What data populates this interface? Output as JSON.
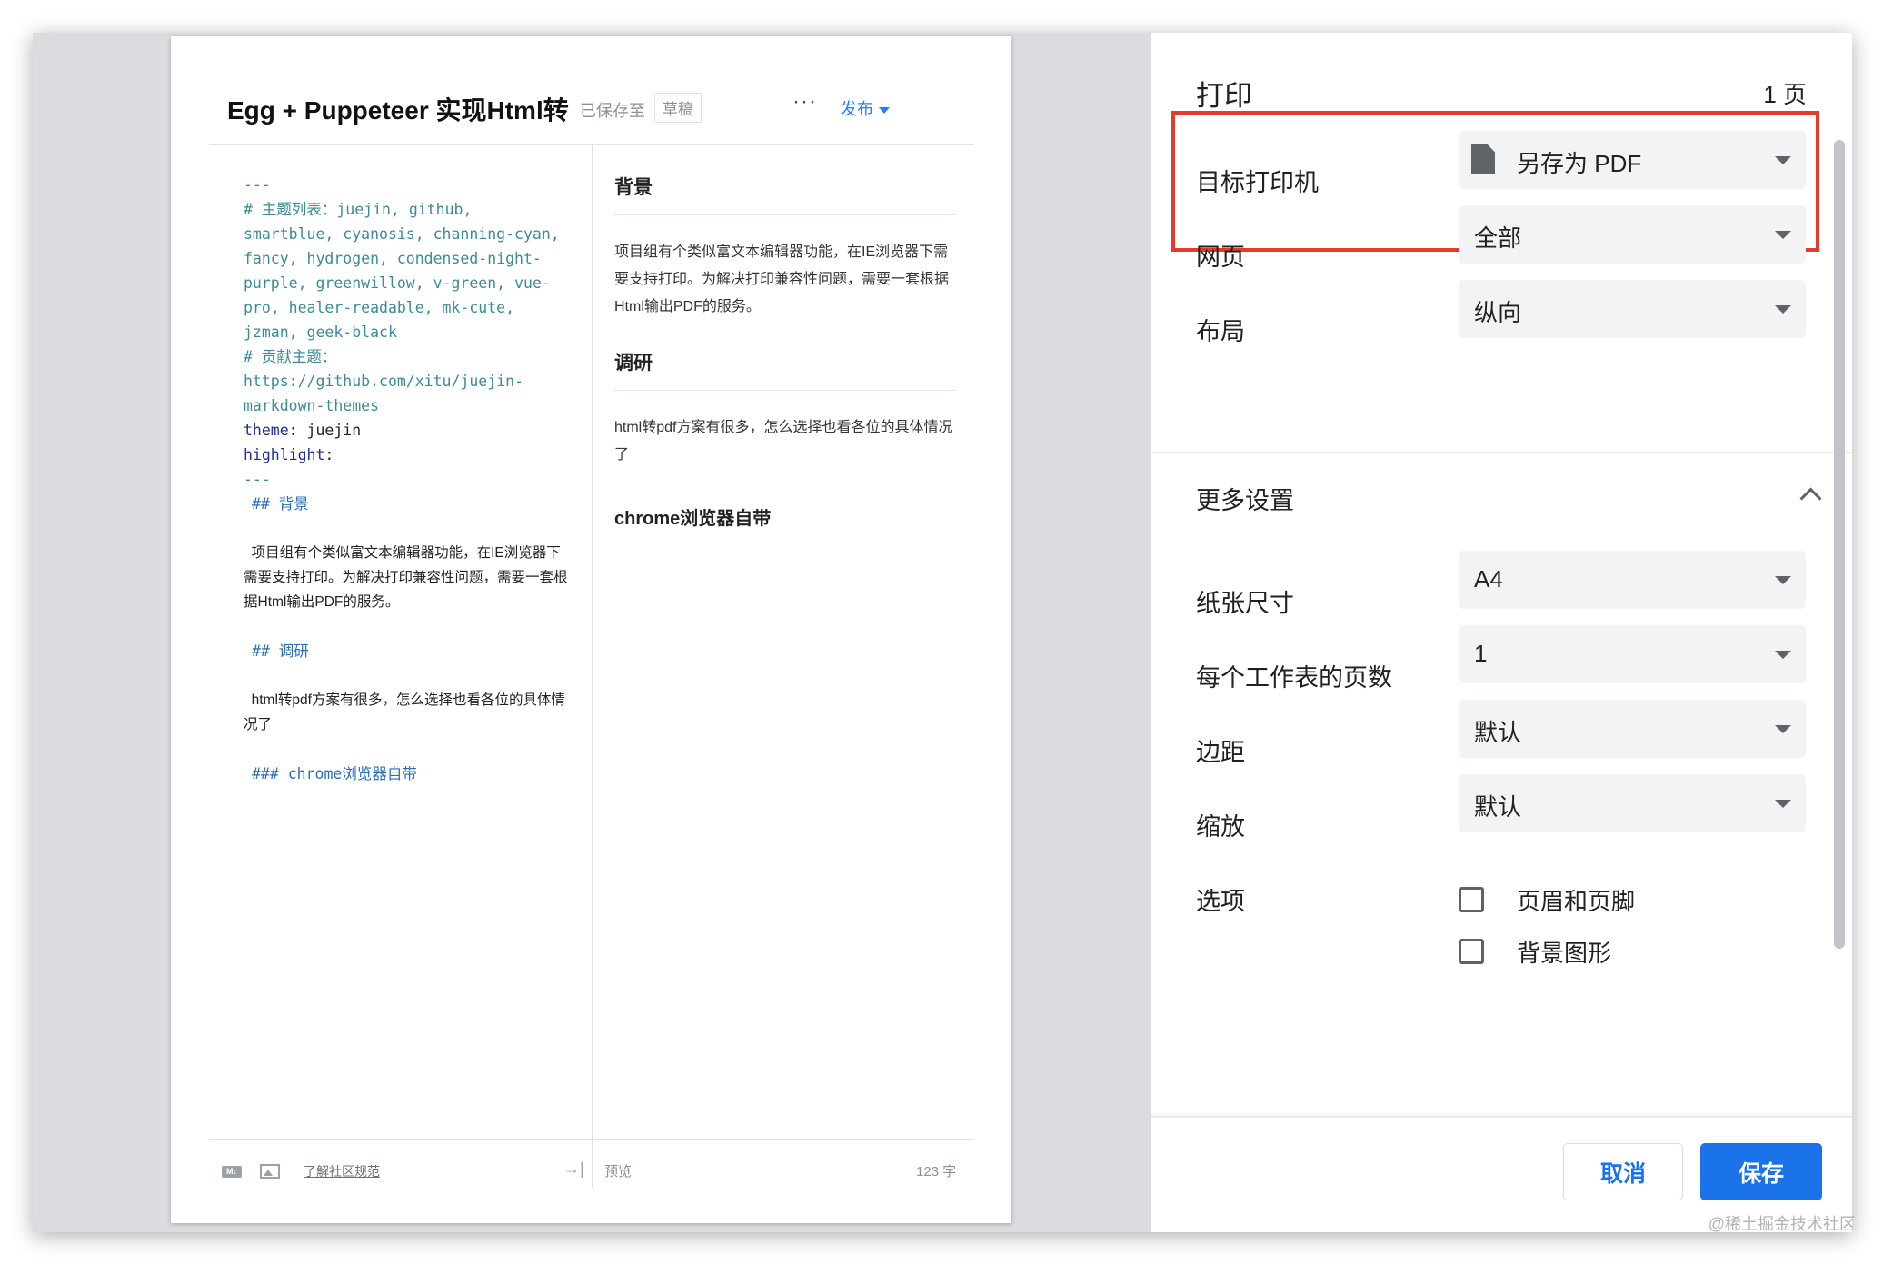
{
  "document": {
    "title": "Egg + Puppeteer 实现Html转",
    "saved_label": "已保存至",
    "draft_badge": "草稿",
    "more_label": "···",
    "publish_label": "发布",
    "markdown_icon_label": "M↓",
    "community_rules_link": "了解社区规范",
    "preview_label": "预览",
    "word_count": "123 字",
    "editor_lines": [
      {
        "text": "---",
        "style": "teal"
      },
      {
        "text": "# 主题列表：juejin, github,",
        "style": "teal"
      },
      {
        "text": "smartblue, cyanosis, channing-cyan,",
        "style": "teal"
      },
      {
        "text": "fancy, hydrogen, condensed-night-",
        "style": "teal"
      },
      {
        "text": "purple, greenwillow, v-green, vue-",
        "style": "teal"
      },
      {
        "text": "pro, healer-readable, mk-cute,",
        "style": "teal"
      },
      {
        "text": "jzman, geek-black",
        "style": "teal"
      },
      {
        "text": "# 贡献主题：",
        "style": "teal"
      },
      {
        "text": "https://github.com/xitu/juejin-",
        "style": "teal"
      },
      {
        "text": "markdown-themes",
        "style": "teal"
      }
    ],
    "theme_key": "theme",
    "theme_value": "juejin",
    "highlight_key": "highlight",
    "front_matter_end": "---",
    "heading_bg": "## 背景",
    "para_bg": "项目组有个类似富文本编辑器功能，在IE浏览器下需要支持打印。为解决打印兼容性问题，需要一套根据Html输出PDF的服务。",
    "heading_research": "## 调研",
    "para_research": "html转pdf方案有很多，怎么选择也看各位的具体情况了",
    "heading_chrome": "### chrome浏览器自带",
    "preview": {
      "h_bg": "背景",
      "p_bg": "项目组有个类似富文本编辑器功能，在IE浏览器下需要支持打印。为解决打印兼容性问题，需要一套根据Html输出PDF的服务。",
      "h_research": "调研",
      "p_research": "html转pdf方案有很多，怎么选择也看各位的具体情况了",
      "h_chrome": "chrome浏览器自带"
    }
  },
  "print": {
    "title": "打印",
    "page_count": "1 页",
    "destination_label": "目标打印机",
    "destination_value": "另存为 PDF",
    "pages_label": "网页",
    "pages_value": "全部",
    "layout_label": "布局",
    "layout_value": "纵向",
    "more_settings_label": "更多设置",
    "paper_size_label": "纸张尺寸",
    "paper_size_value": "A4",
    "pages_per_sheet_label": "每个工作表的页数",
    "pages_per_sheet_value": "1",
    "margins_label": "边距",
    "margins_value": "默认",
    "scale_label": "缩放",
    "scale_value": "默认",
    "options_label": "选项",
    "option_headers_footers": "页眉和页脚",
    "option_background_graphics": "背景图形",
    "cancel_label": "取消",
    "save_label": "保存"
  },
  "watermark": "@稀土掘金技术社区",
  "colors": {
    "accent_blue": "#1a73e8",
    "highlight_red": "#e53b2c",
    "link_blue": "#1e80ff"
  }
}
